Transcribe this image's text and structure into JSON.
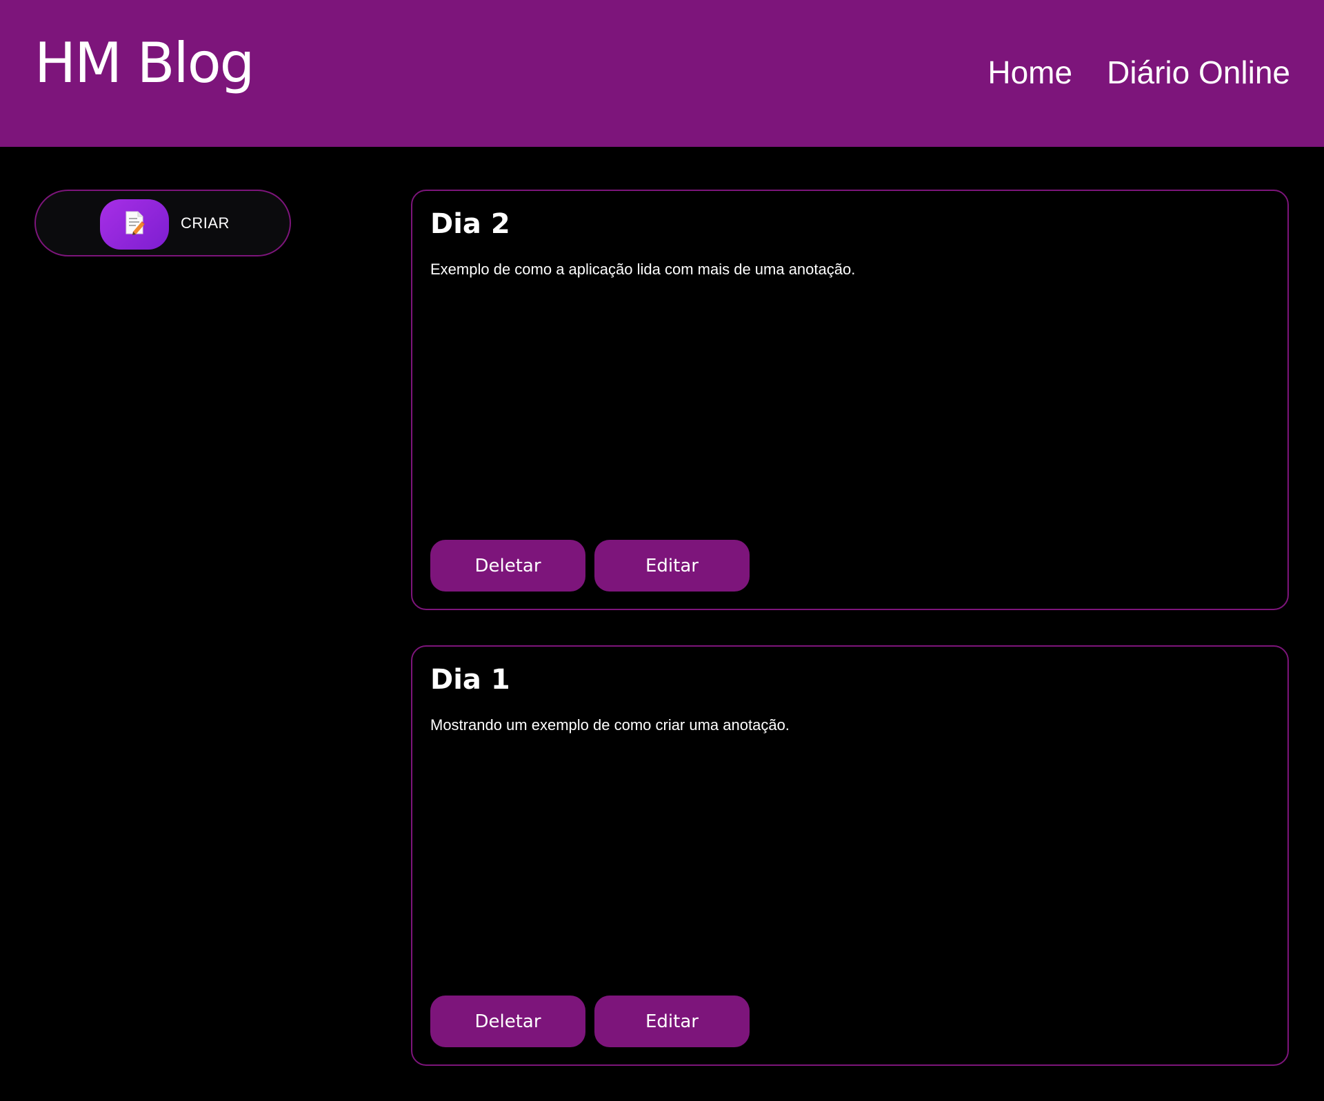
{
  "header": {
    "logo": "HM Blog",
    "nav": [
      {
        "label": "Home"
      },
      {
        "label": "Diário Online"
      }
    ]
  },
  "sidebar": {
    "create_label": "CRIAR",
    "create_icon": "memo-icon"
  },
  "notes": [
    {
      "title": "Dia 2",
      "body": "Exemplo de como a aplicação lida com mais de uma anotação.",
      "delete_label": "Deletar",
      "edit_label": "Editar"
    },
    {
      "title": "Dia 1",
      "body": "Mostrando um exemplo de como criar uma anotação.",
      "delete_label": "Deletar",
      "edit_label": "Editar"
    }
  ],
  "colors": {
    "brand": "#7d157b",
    "background": "#000000",
    "text": "#ffffff",
    "accent_gradient_start": "#a72fe6",
    "accent_gradient_end": "#7d1ed0"
  }
}
